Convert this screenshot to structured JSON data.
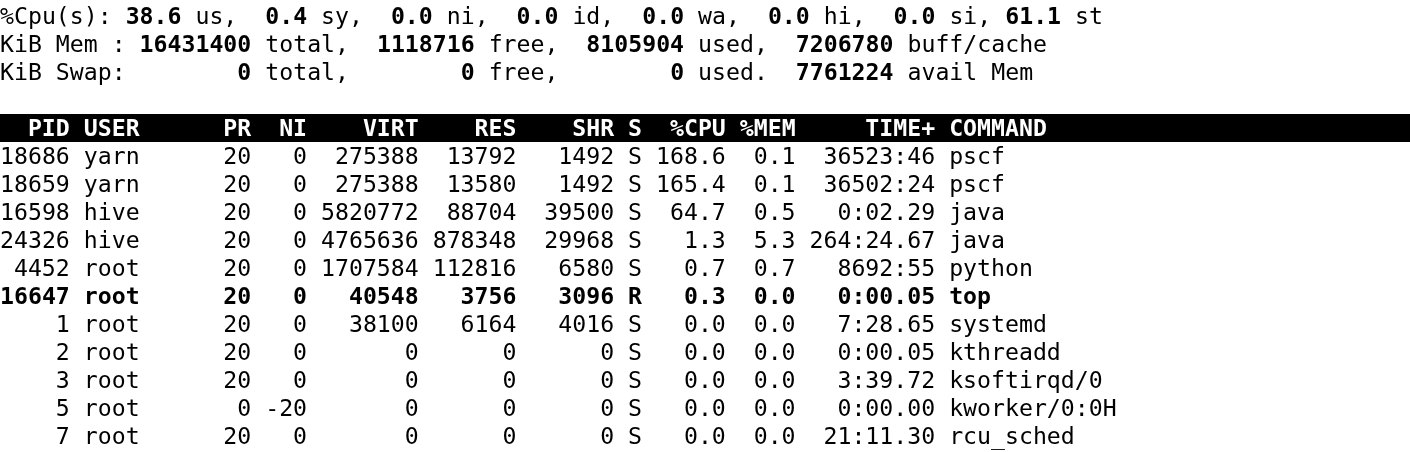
{
  "summary_lines": [
    "%Cpu(s): **38.6** us,  **0.4** sy,  **0.0** ni,  **0.0** id,  **0.0** wa,  **0.0** hi,  **0.0** si, **61.1** st",
    "KiB Mem : **16431400** total,  **1118716** free,  **8105904** used,  **7206780** buff/cache",
    "KiB Swap:        **0** total,        **0** free,        **0** used.  **7761224** avail Mem"
  ],
  "table": {
    "columns": [
      "PID",
      "USER",
      "PR",
      "NI",
      "VIRT",
      "RES",
      "SHR",
      "S",
      "%CPU",
      "%MEM",
      "TIME+",
      "COMMAND"
    ],
    "rows": [
      {
        "highlighted": false,
        "cells": [
          "18686",
          "yarn",
          "20",
          "0",
          "275388",
          "13792",
          "1492",
          "S",
          "168.6",
          "0.1",
          "36523:46",
          "pscf"
        ]
      },
      {
        "highlighted": false,
        "cells": [
          "18659",
          "yarn",
          "20",
          "0",
          "275388",
          "13580",
          "1492",
          "S",
          "165.4",
          "0.1",
          "36502:24",
          "pscf"
        ]
      },
      {
        "highlighted": false,
        "cells": [
          "16598",
          "hive",
          "20",
          "0",
          "5820772",
          "88704",
          "39500",
          "S",
          "64.7",
          "0.5",
          "0:02.29",
          "java"
        ]
      },
      {
        "highlighted": false,
        "cells": [
          "24326",
          "hive",
          "20",
          "0",
          "4765636",
          "878348",
          "29968",
          "S",
          "1.3",
          "5.3",
          "264:24.67",
          "java"
        ]
      },
      {
        "highlighted": false,
        "cells": [
          "4452",
          "root",
          "20",
          "0",
          "1707584",
          "112816",
          "6580",
          "S",
          "0.7",
          "0.7",
          "8692:55",
          "python"
        ]
      },
      {
        "highlighted": true,
        "cells": [
          "16647",
          "root",
          "20",
          "0",
          "40548",
          "3756",
          "3096",
          "R",
          "0.3",
          "0.0",
          "0:00.05",
          "top"
        ]
      },
      {
        "highlighted": false,
        "cells": [
          "1",
          "root",
          "20",
          "0",
          "38100",
          "6164",
          "4016",
          "S",
          "0.0",
          "0.0",
          "7:28.65",
          "systemd"
        ]
      },
      {
        "highlighted": false,
        "cells": [
          "2",
          "root",
          "20",
          "0",
          "0",
          "0",
          "0",
          "S",
          "0.0",
          "0.0",
          "0:00.05",
          "kthreadd"
        ]
      },
      {
        "highlighted": false,
        "cells": [
          "3",
          "root",
          "20",
          "0",
          "0",
          "0",
          "0",
          "S",
          "0.0",
          "0.0",
          "3:39.72",
          "ksoftirqd/0"
        ]
      },
      {
        "highlighted": false,
        "cells": [
          "5",
          "root",
          "0",
          "-20",
          "0",
          "0",
          "0",
          "S",
          "0.0",
          "0.0",
          "0:00.00",
          "kworker/0:0H"
        ]
      },
      {
        "highlighted": false,
        "cells": [
          "7",
          "root",
          "20",
          "0",
          "0",
          "0",
          "0",
          "S",
          "0.0",
          "0.0",
          "21:11.30",
          "rcu_sched"
        ]
      }
    ]
  }
}
